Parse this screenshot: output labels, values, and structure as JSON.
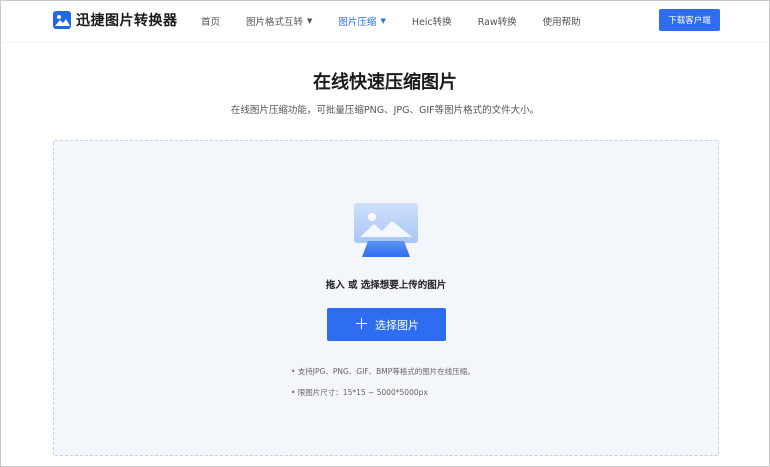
{
  "header": {
    "logo_text": "迅捷图片转换器",
    "nav": [
      {
        "label": "首页"
      },
      {
        "label": "图片格式互转"
      },
      {
        "label": "图片压缩"
      },
      {
        "label": "Heic转换"
      },
      {
        "label": "Raw转换"
      },
      {
        "label": "使用帮助"
      }
    ],
    "download_label": "下载客户端"
  },
  "main": {
    "title": "在线快速压缩图片",
    "subtitle": "在线图片压缩功能，可批量压缩PNG、JPG、GIF等图片格式的文件大小。",
    "drop_text": "拖入 或 选择想要上传的图片",
    "select_button": "选择图片",
    "tips": [
      "• 支持JPG、PNG、GIF、BMP等格式的图片在线压缩。",
      "• 限图片尺寸：15*15 ~ 5000*5000px"
    ]
  },
  "colors": {
    "accent": "#2f6df0",
    "drop_zone_bg": "#f3f6fb",
    "drop_zone_border": "#c7d3e4"
  },
  "icons": {
    "logo": "image-icon",
    "nav_dropdown": "chevron-down-icon",
    "upload_illustration": "image-upload-icon",
    "add": "plus-icon"
  }
}
